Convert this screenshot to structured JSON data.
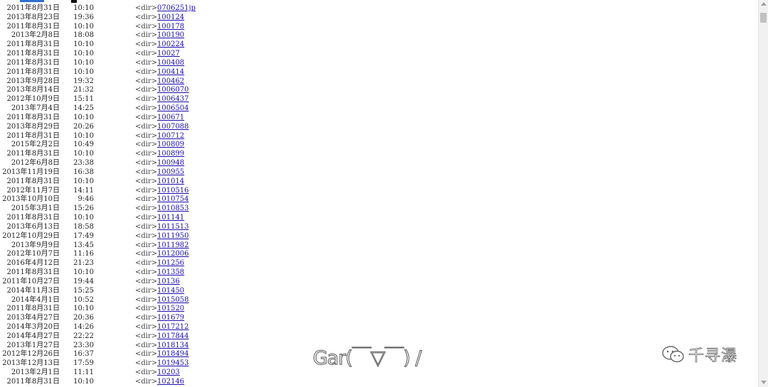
{
  "colors": {
    "link": "#1a0dab",
    "accent_top_left": "#2f6fd1",
    "accent_top_mark": "#111111",
    "watermark_outline": "#555555"
  },
  "listing": {
    "rows": [
      {
        "date": "2011年8月31日",
        "time": "10:10",
        "type": "<dir>",
        "name": "0706251jp"
      },
      {
        "date": "2013年8月23日",
        "time": "19:36",
        "type": "<dir>",
        "name": "100124"
      },
      {
        "date": "2011年8月31日",
        "time": "10:10",
        "type": "<dir>",
        "name": "100178"
      },
      {
        "date": "2013年2月8日",
        "time": "18:08",
        "type": "<dir>",
        "name": "100190"
      },
      {
        "date": "2011年8月31日",
        "time": "10:10",
        "type": "<dir>",
        "name": "100224"
      },
      {
        "date": "2011年8月31日",
        "time": "10:10",
        "type": "<dir>",
        "name": "10027"
      },
      {
        "date": "2011年8月31日",
        "time": "10:10",
        "type": "<dir>",
        "name": "100408"
      },
      {
        "date": "2011年8月31日",
        "time": "10:10",
        "type": "<dir>",
        "name": "100414"
      },
      {
        "date": "2013年9月28日",
        "time": "19:32",
        "type": "<dir>",
        "name": "100462"
      },
      {
        "date": "2013年8月14日",
        "time": "21:32",
        "type": "<dir>",
        "name": "1006070"
      },
      {
        "date": "2012年10月9日",
        "time": "15:11",
        "type": "<dir>",
        "name": "1006437"
      },
      {
        "date": "2013年7月4日",
        "time": "14:25",
        "type": "<dir>",
        "name": "1006504"
      },
      {
        "date": "2011年8月31日",
        "time": "10:10",
        "type": "<dir>",
        "name": "100671"
      },
      {
        "date": "2013年8月29日",
        "time": "20:26",
        "type": "<dir>",
        "name": "1007088"
      },
      {
        "date": "2011年8月31日",
        "time": "10:10",
        "type": "<dir>",
        "name": "100712"
      },
      {
        "date": "2015年2月2日",
        "time": "10:49",
        "type": "<dir>",
        "name": "100809"
      },
      {
        "date": "2011年8月31日",
        "time": "10:10",
        "type": "<dir>",
        "name": "100899"
      },
      {
        "date": "2012年6月8日",
        "time": "23:38",
        "type": "<dir>",
        "name": "100948"
      },
      {
        "date": "2013年11月19日",
        "time": "16:38",
        "type": "<dir>",
        "name": "100955"
      },
      {
        "date": "2011年8月31日",
        "time": "10:10",
        "type": "<dir>",
        "name": "101014"
      },
      {
        "date": "2012年11月7日",
        "time": "14:11",
        "type": "<dir>",
        "name": "1010516"
      },
      {
        "date": "2013年10月10日",
        "time": "9:46",
        "type": "<dir>",
        "name": "1010754"
      },
      {
        "date": "2015年3月1日",
        "time": "15:26",
        "type": "<dir>",
        "name": "1010853"
      },
      {
        "date": "2011年8月31日",
        "time": "10:10",
        "type": "<dir>",
        "name": "101141"
      },
      {
        "date": "2013年6月13日",
        "time": "18:58",
        "type": "<dir>",
        "name": "1011513"
      },
      {
        "date": "2012年10月29日",
        "time": "17:49",
        "type": "<dir>",
        "name": "1011950"
      },
      {
        "date": "2013年9月9日",
        "time": "13:45",
        "type": "<dir>",
        "name": "1011982"
      },
      {
        "date": "2012年10月7日",
        "time": "11:16",
        "type": "<dir>",
        "name": "1012006"
      },
      {
        "date": "2016年4月12日",
        "time": "21:23",
        "type": "<dir>",
        "name": "101256"
      },
      {
        "date": "2011年8月31日",
        "time": "10:10",
        "type": "<dir>",
        "name": "101358"
      },
      {
        "date": "2011年10月27日",
        "time": "19:44",
        "type": "<dir>",
        "name": "10136"
      },
      {
        "date": "2014年11月3日",
        "time": "15:25",
        "type": "<dir>",
        "name": "101450"
      },
      {
        "date": "2014年4月1日",
        "time": "10:52",
        "type": "<dir>",
        "name": "1015058"
      },
      {
        "date": "2011年8月31日",
        "time": "10:10",
        "type": "<dir>",
        "name": "101520"
      },
      {
        "date": "2013年4月27日",
        "time": "20:36",
        "type": "<dir>",
        "name": "101679"
      },
      {
        "date": "2014年3月20日",
        "time": "14:26",
        "type": "<dir>",
        "name": "1017212"
      },
      {
        "date": "2014年4月27日",
        "time": "22:22",
        "type": "<dir>",
        "name": "1017844"
      },
      {
        "date": "2013年1月27日",
        "time": "23:30",
        "type": "<dir>",
        "name": "1018134"
      },
      {
        "date": "2012年12月26日",
        "time": "16:37",
        "type": "<dir>",
        "name": "1018494"
      },
      {
        "date": "2013年12月13日",
        "time": "17:59",
        "type": "<dir>",
        "name": "1019453"
      },
      {
        "date": "2013年2月1日",
        "time": "11:11",
        "type": "<dir>",
        "name": "10203"
      },
      {
        "date": "2011年8月31日",
        "time": "10:10",
        "type": "<dir>",
        "name": "102146"
      }
    ]
  },
  "overlay": {
    "caption": "Gar(￣▽￣) /"
  },
  "brand": {
    "icon": "wechat-icon",
    "name": "千寻瀑"
  }
}
